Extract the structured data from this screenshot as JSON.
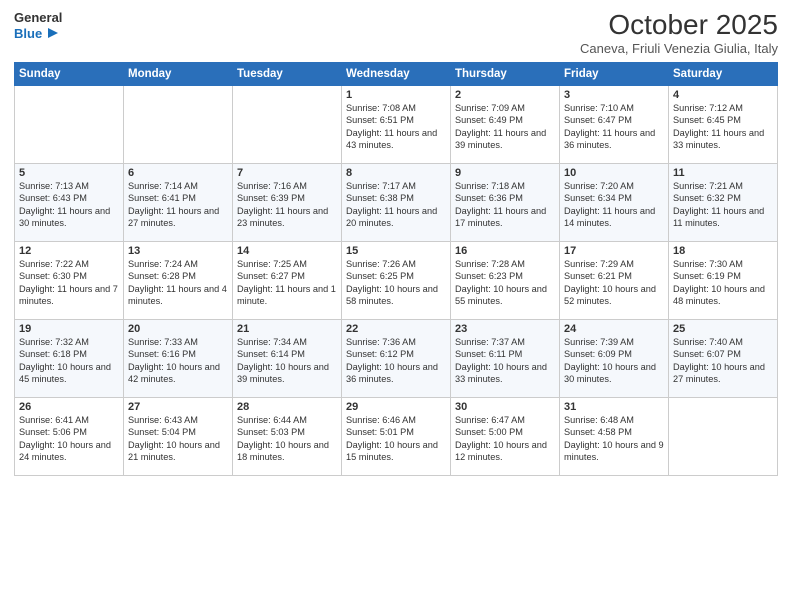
{
  "logo": {
    "line1": "General",
    "line2": "Blue"
  },
  "title": "October 2025",
  "location": "Caneva, Friuli Venezia Giulia, Italy",
  "days_of_week": [
    "Sunday",
    "Monday",
    "Tuesday",
    "Wednesday",
    "Thursday",
    "Friday",
    "Saturday"
  ],
  "weeks": [
    [
      {
        "day": "",
        "info": ""
      },
      {
        "day": "",
        "info": ""
      },
      {
        "day": "",
        "info": ""
      },
      {
        "day": "1",
        "info": "Sunrise: 7:08 AM\nSunset: 6:51 PM\nDaylight: 11 hours\nand 43 minutes."
      },
      {
        "day": "2",
        "info": "Sunrise: 7:09 AM\nSunset: 6:49 PM\nDaylight: 11 hours\nand 39 minutes."
      },
      {
        "day": "3",
        "info": "Sunrise: 7:10 AM\nSunset: 6:47 PM\nDaylight: 11 hours\nand 36 minutes."
      },
      {
        "day": "4",
        "info": "Sunrise: 7:12 AM\nSunset: 6:45 PM\nDaylight: 11 hours\nand 33 minutes."
      }
    ],
    [
      {
        "day": "5",
        "info": "Sunrise: 7:13 AM\nSunset: 6:43 PM\nDaylight: 11 hours\nand 30 minutes."
      },
      {
        "day": "6",
        "info": "Sunrise: 7:14 AM\nSunset: 6:41 PM\nDaylight: 11 hours\nand 27 minutes."
      },
      {
        "day": "7",
        "info": "Sunrise: 7:16 AM\nSunset: 6:39 PM\nDaylight: 11 hours\nand 23 minutes."
      },
      {
        "day": "8",
        "info": "Sunrise: 7:17 AM\nSunset: 6:38 PM\nDaylight: 11 hours\nand 20 minutes."
      },
      {
        "day": "9",
        "info": "Sunrise: 7:18 AM\nSunset: 6:36 PM\nDaylight: 11 hours\nand 17 minutes."
      },
      {
        "day": "10",
        "info": "Sunrise: 7:20 AM\nSunset: 6:34 PM\nDaylight: 11 hours\nand 14 minutes."
      },
      {
        "day": "11",
        "info": "Sunrise: 7:21 AM\nSunset: 6:32 PM\nDaylight: 11 hours\nand 11 minutes."
      }
    ],
    [
      {
        "day": "12",
        "info": "Sunrise: 7:22 AM\nSunset: 6:30 PM\nDaylight: 11 hours\nand 7 minutes."
      },
      {
        "day": "13",
        "info": "Sunrise: 7:24 AM\nSunset: 6:28 PM\nDaylight: 11 hours\nand 4 minutes."
      },
      {
        "day": "14",
        "info": "Sunrise: 7:25 AM\nSunset: 6:27 PM\nDaylight: 11 hours\nand 1 minute."
      },
      {
        "day": "15",
        "info": "Sunrise: 7:26 AM\nSunset: 6:25 PM\nDaylight: 10 hours\nand 58 minutes."
      },
      {
        "day": "16",
        "info": "Sunrise: 7:28 AM\nSunset: 6:23 PM\nDaylight: 10 hours\nand 55 minutes."
      },
      {
        "day": "17",
        "info": "Sunrise: 7:29 AM\nSunset: 6:21 PM\nDaylight: 10 hours\nand 52 minutes."
      },
      {
        "day": "18",
        "info": "Sunrise: 7:30 AM\nSunset: 6:19 PM\nDaylight: 10 hours\nand 48 minutes."
      }
    ],
    [
      {
        "day": "19",
        "info": "Sunrise: 7:32 AM\nSunset: 6:18 PM\nDaylight: 10 hours\nand 45 minutes."
      },
      {
        "day": "20",
        "info": "Sunrise: 7:33 AM\nSunset: 6:16 PM\nDaylight: 10 hours\nand 42 minutes."
      },
      {
        "day": "21",
        "info": "Sunrise: 7:34 AM\nSunset: 6:14 PM\nDaylight: 10 hours\nand 39 minutes."
      },
      {
        "day": "22",
        "info": "Sunrise: 7:36 AM\nSunset: 6:12 PM\nDaylight: 10 hours\nand 36 minutes."
      },
      {
        "day": "23",
        "info": "Sunrise: 7:37 AM\nSunset: 6:11 PM\nDaylight: 10 hours\nand 33 minutes."
      },
      {
        "day": "24",
        "info": "Sunrise: 7:39 AM\nSunset: 6:09 PM\nDaylight: 10 hours\nand 30 minutes."
      },
      {
        "day": "25",
        "info": "Sunrise: 7:40 AM\nSunset: 6:07 PM\nDaylight: 10 hours\nand 27 minutes."
      }
    ],
    [
      {
        "day": "26",
        "info": "Sunrise: 6:41 AM\nSunset: 5:06 PM\nDaylight: 10 hours\nand 24 minutes."
      },
      {
        "day": "27",
        "info": "Sunrise: 6:43 AM\nSunset: 5:04 PM\nDaylight: 10 hours\nand 21 minutes."
      },
      {
        "day": "28",
        "info": "Sunrise: 6:44 AM\nSunset: 5:03 PM\nDaylight: 10 hours\nand 18 minutes."
      },
      {
        "day": "29",
        "info": "Sunrise: 6:46 AM\nSunset: 5:01 PM\nDaylight: 10 hours\nand 15 minutes."
      },
      {
        "day": "30",
        "info": "Sunrise: 6:47 AM\nSunset: 5:00 PM\nDaylight: 10 hours\nand 12 minutes."
      },
      {
        "day": "31",
        "info": "Sunrise: 6:48 AM\nSunset: 4:58 PM\nDaylight: 10 hours\nand 9 minutes."
      },
      {
        "day": "",
        "info": ""
      }
    ]
  ]
}
